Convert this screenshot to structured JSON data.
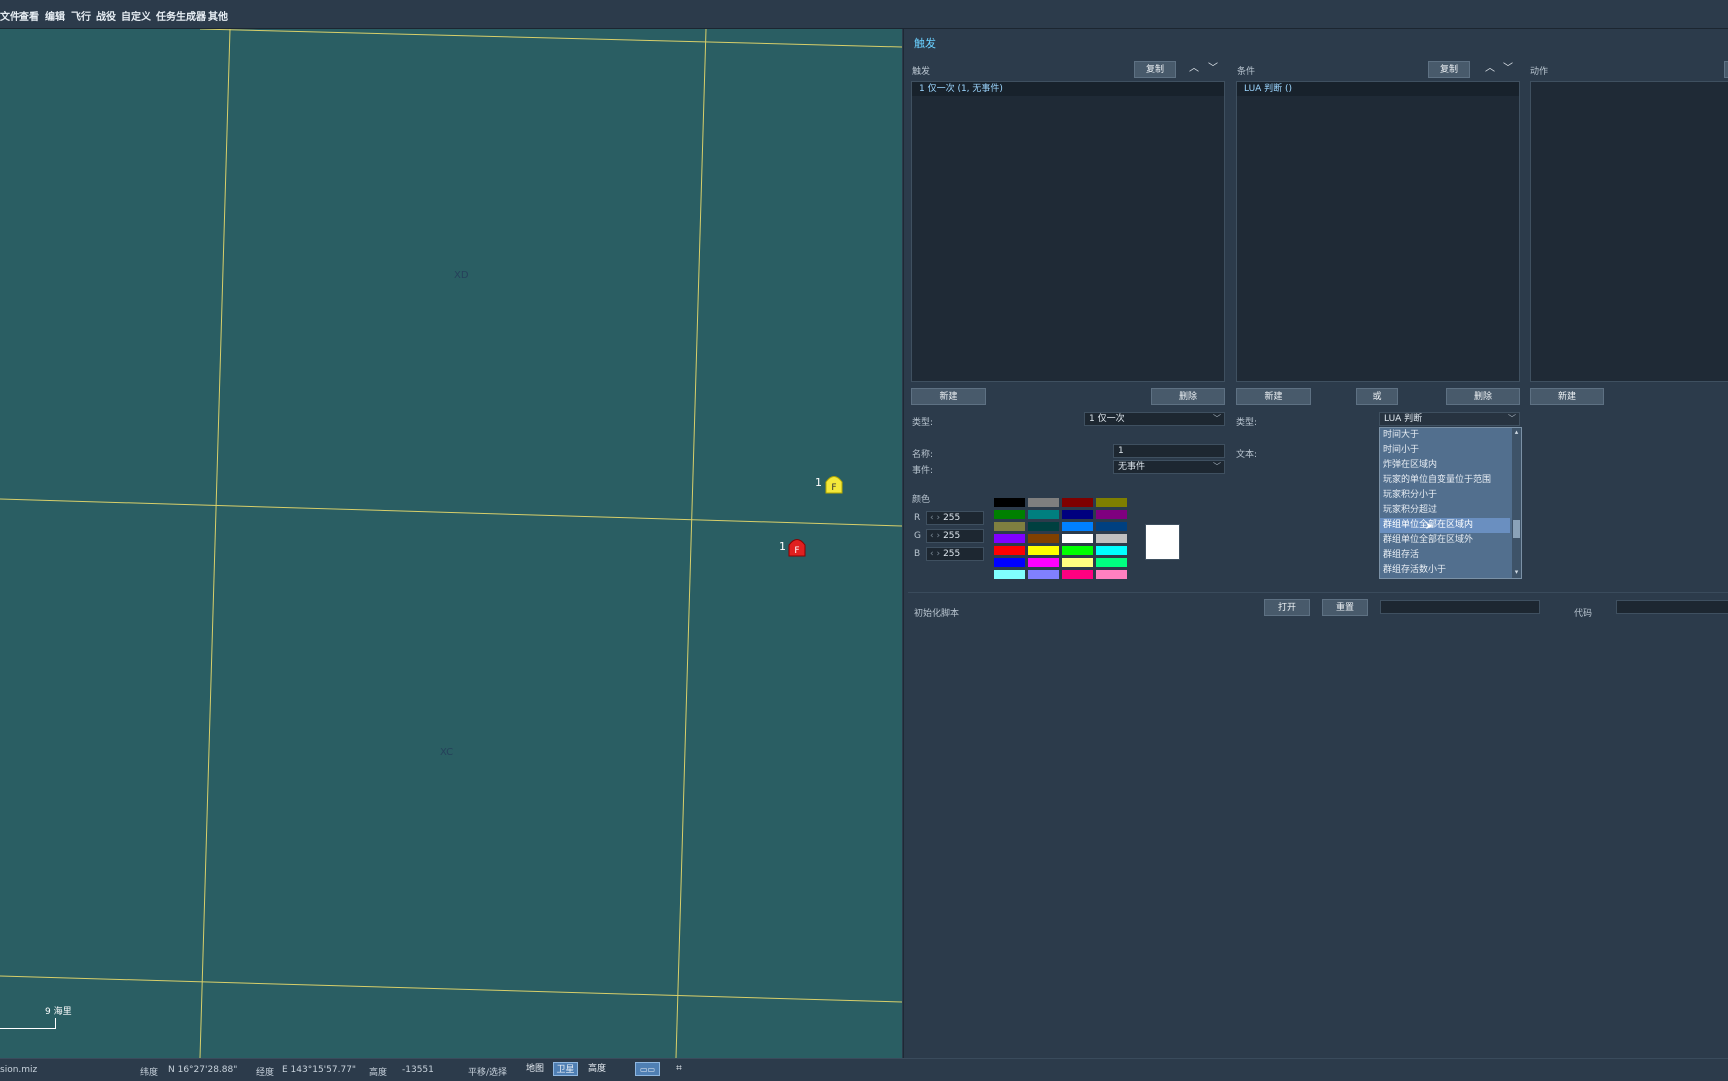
{
  "menu": [
    "文件",
    "查看",
    "编辑",
    "飞行",
    "战役",
    "自定义",
    "任务生成器",
    "其他"
  ],
  "map": {
    "zone_labels": [
      "XD",
      "XC"
    ],
    "units": [
      {
        "label": "1",
        "badge": "F",
        "color": "#f3e83a"
      },
      {
        "label": "1",
        "badge": "F",
        "color": "#e02020"
      }
    ],
    "scale_label": "9 海里"
  },
  "panel": {
    "title": "触发",
    "triggers": {
      "header": "触发",
      "copy": "复制",
      "items": [
        "1 仅一次 (1, 无事件)"
      ],
      "new": "新建",
      "delete": "删除"
    },
    "conditions": {
      "header": "条件",
      "copy": "复制",
      "items": [
        "LUA 判断 ()"
      ],
      "new": "新建",
      "or": "或",
      "delete": "删除"
    },
    "actions": {
      "header": "动作",
      "new": "新建"
    },
    "trigger_props": {
      "type_label": "类型:",
      "type_value": "1 仅一次",
      "name_label": "名称:",
      "name_value": "1",
      "event_label": "事件:",
      "event_value": "无事件",
      "color_label": "颜色",
      "r_label": "R",
      "r_value": "255",
      "g_label": "G",
      "g_value": "255",
      "b_label": "B",
      "b_value": "255"
    },
    "condition_props": {
      "type_label": "类型:",
      "type_value": "LUA 判断",
      "text_label": "文本:",
      "dropdown_options": [
        "时间大于",
        "时间小于",
        "炸弹在区域内",
        "玩家的单位自变量位于范围",
        "玩家积分小于",
        "玩家积分超过",
        "群组单位全部在区域内",
        "群组单位全部在区域外",
        "群组存活",
        "群组存活数小于"
      ],
      "dropdown_selected": "群组单位全部在区域内"
    },
    "palette": [
      "#000000",
      "#7f7f7f",
      "#7f0000",
      "#7f7f00",
      "#008000",
      "#007f7f",
      "#00007f",
      "#7f007f",
      "#7f7f40",
      "#004040",
      "#0080ff",
      "#004080",
      "#8000ff",
      "#804000",
      "#ffffff",
      "#c0c0c0",
      "#ff0000",
      "#ffff00",
      "#00ff00",
      "#00ffff",
      "#0000ff",
      "#ff00ff",
      "#ffff80",
      "#00ff80",
      "#80ffff",
      "#8080ff",
      "#ff0080",
      "#ff80c0"
    ],
    "preview_color": "#ffffff",
    "init_script": {
      "label": "初始化脚本",
      "open": "打开",
      "reset": "重置",
      "code_label": "代码"
    }
  },
  "status": {
    "file": "sion.miz",
    "lat_label": "纬度",
    "lat_value": "N 16°27'28.88\"",
    "lon_label": "经度",
    "lon_value": "E 143°15'57.77\"",
    "alt_label": "高度",
    "alt_value": "-13551",
    "mode": "平移/选择",
    "btn_map": "地图",
    "btn_sat": "卫星",
    "btn_alt": "高度"
  }
}
